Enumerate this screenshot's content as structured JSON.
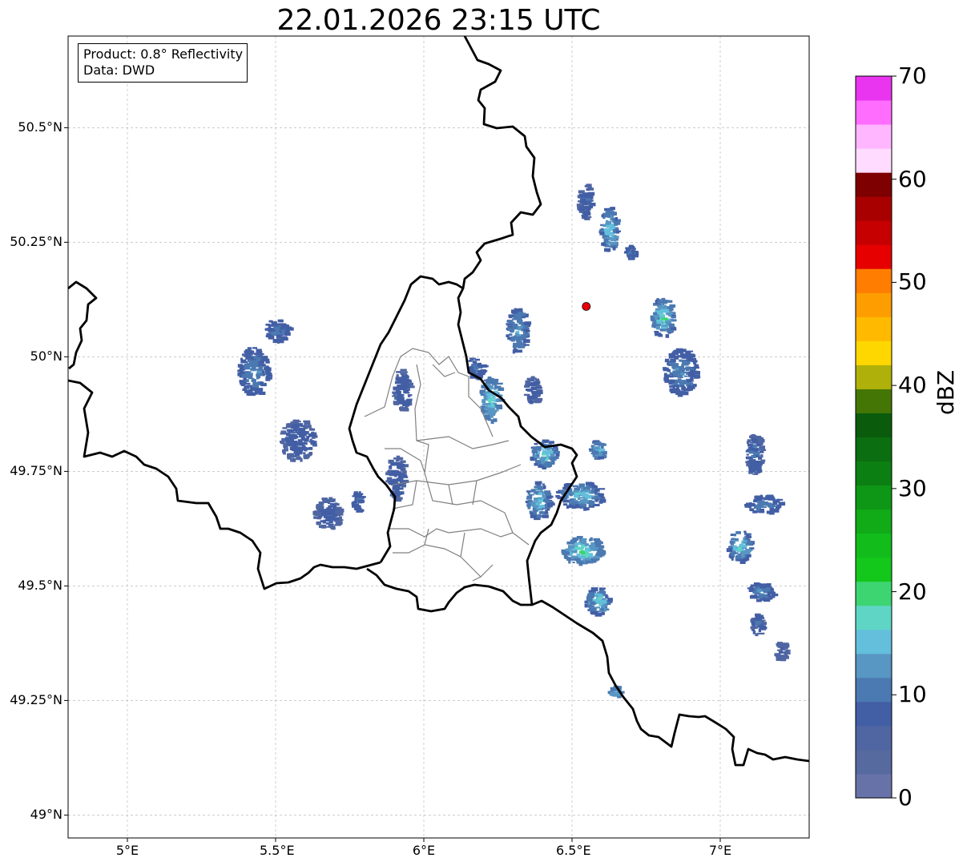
{
  "title": "22.01.2026 23:15 UTC",
  "info": {
    "product": "Product: 0.8° Reflectivity",
    "data": "Data: DWD"
  },
  "map": {
    "lon_range": [
      4.8,
      7.3
    ],
    "lat_range": [
      48.95,
      50.7
    ],
    "lon_ticks": [
      {
        "value": 5.0,
        "label": "5°E"
      },
      {
        "value": 5.5,
        "label": "5.5°E"
      },
      {
        "value": 6.0,
        "label": "6°E"
      },
      {
        "value": 6.5,
        "label": "6.5°E"
      },
      {
        "value": 7.0,
        "label": "7°E"
      }
    ],
    "lat_ticks": [
      {
        "value": 49.0,
        "label": "49°N"
      },
      {
        "value": 49.25,
        "label": "49.25°N"
      },
      {
        "value": 49.5,
        "label": "49.5°N"
      },
      {
        "value": 49.75,
        "label": "49.75°N"
      },
      {
        "value": 50.0,
        "label": "50°N"
      },
      {
        "value": 50.25,
        "label": "50.25°N"
      },
      {
        "value": 50.5,
        "label": "50.5°N"
      }
    ],
    "radar_site": {
      "lon": 6.548,
      "lat": 50.11,
      "color": "#e8000b"
    },
    "gridlines": true
  },
  "colorbar": {
    "label": "dBZ",
    "min": 0,
    "max": 70,
    "step": 2.5,
    "tick_values": [
      0,
      10,
      20,
      30,
      40,
      50,
      60,
      70
    ],
    "colors": [
      "#6773a8",
      "#566a9f",
      "#4f66a2",
      "#425ea5",
      "#4b79b1",
      "#5896c3",
      "#63bfdc",
      "#5fd6c5",
      "#3dd572",
      "#14c71b",
      "#11bc1b",
      "#11ab18",
      "#0e9716",
      "#0c7f12",
      "#0b6e10",
      "#0a5c0c",
      "#447605",
      "#afb10a",
      "#ffd700",
      "#ffba00",
      "#fe9d00",
      "#ff7d00",
      "#e60000",
      "#c60000",
      "#a80000",
      "#7e0000",
      "#ffdcff",
      "#ffb6ff",
      "#ff6dff",
      "#e935f0"
    ]
  },
  "echo_cells": [
    {
      "lon": 5.42,
      "lat": 49.97,
      "w": 0.1,
      "h": 0.11,
      "dbz": 8,
      "core": 14
    },
    {
      "lon": 5.5,
      "lat": 50.06,
      "w": 0.08,
      "h": 0.05,
      "dbz": 8,
      "core": 12
    },
    {
      "lon": 5.57,
      "lat": 49.82,
      "w": 0.12,
      "h": 0.09,
      "dbz": 7,
      "core": 10
    },
    {
      "lon": 5.67,
      "lat": 49.66,
      "w": 0.09,
      "h": 0.07,
      "dbz": 7,
      "core": 9
    },
    {
      "lon": 5.77,
      "lat": 49.69,
      "w": 0.03,
      "h": 0.05,
      "dbz": 8,
      "core": 12
    },
    {
      "lon": 5.92,
      "lat": 49.93,
      "w": 0.06,
      "h": 0.09,
      "dbz": 7,
      "core": 10
    },
    {
      "lon": 5.9,
      "lat": 49.74,
      "w": 0.06,
      "h": 0.1,
      "dbz": 7,
      "core": 10
    },
    {
      "lon": 6.17,
      "lat": 49.98,
      "w": 0.05,
      "h": 0.05,
      "dbz": 8,
      "core": 12
    },
    {
      "lon": 6.22,
      "lat": 49.91,
      "w": 0.07,
      "h": 0.1,
      "dbz": 10,
      "core": 20
    },
    {
      "lon": 6.31,
      "lat": 50.06,
      "w": 0.07,
      "h": 0.1,
      "dbz": 9,
      "core": 15
    },
    {
      "lon": 6.36,
      "lat": 49.93,
      "w": 0.05,
      "h": 0.06,
      "dbz": 7,
      "core": 10
    },
    {
      "lon": 6.4,
      "lat": 49.79,
      "w": 0.09,
      "h": 0.06,
      "dbz": 9,
      "core": 20
    },
    {
      "lon": 6.38,
      "lat": 49.69,
      "w": 0.08,
      "h": 0.08,
      "dbz": 9,
      "core": 19
    },
    {
      "lon": 6.52,
      "lat": 49.7,
      "w": 0.16,
      "h": 0.06,
      "dbz": 8,
      "core": 19
    },
    {
      "lon": 6.58,
      "lat": 49.8,
      "w": 0.05,
      "h": 0.04,
      "dbz": 9,
      "core": 20
    },
    {
      "lon": 6.53,
      "lat": 49.58,
      "w": 0.14,
      "h": 0.06,
      "dbz": 10,
      "core": 22
    },
    {
      "lon": 6.58,
      "lat": 49.47,
      "w": 0.08,
      "h": 0.06,
      "dbz": 9,
      "core": 20
    },
    {
      "lon": 6.64,
      "lat": 49.27,
      "w": 0.04,
      "h": 0.03,
      "dbz": 10,
      "core": 16
    },
    {
      "lon": 6.54,
      "lat": 50.34,
      "w": 0.05,
      "h": 0.08,
      "dbz": 7,
      "core": 11
    },
    {
      "lon": 6.62,
      "lat": 50.28,
      "w": 0.06,
      "h": 0.1,
      "dbz": 9,
      "core": 20
    },
    {
      "lon": 6.69,
      "lat": 50.23,
      "w": 0.03,
      "h": 0.03,
      "dbz": 8,
      "core": 12
    },
    {
      "lon": 6.8,
      "lat": 50.09,
      "w": 0.08,
      "h": 0.09,
      "dbz": 9,
      "core": 22
    },
    {
      "lon": 6.86,
      "lat": 49.97,
      "w": 0.11,
      "h": 0.1,
      "dbz": 8,
      "core": 14
    },
    {
      "lon": 7.11,
      "lat": 49.79,
      "w": 0.06,
      "h": 0.09,
      "dbz": 7,
      "core": 12
    },
    {
      "lon": 7.14,
      "lat": 49.68,
      "w": 0.12,
      "h": 0.04,
      "dbz": 8,
      "core": 13
    },
    {
      "lon": 7.06,
      "lat": 49.59,
      "w": 0.08,
      "h": 0.07,
      "dbz": 9,
      "core": 20
    },
    {
      "lon": 7.13,
      "lat": 49.49,
      "w": 0.09,
      "h": 0.04,
      "dbz": 8,
      "core": 14
    },
    {
      "lon": 7.12,
      "lat": 49.42,
      "w": 0.04,
      "h": 0.05,
      "dbz": 7,
      "core": 11
    },
    {
      "lon": 7.2,
      "lat": 49.36,
      "w": 0.04,
      "h": 0.04,
      "dbz": 6,
      "core": 8
    }
  ]
}
